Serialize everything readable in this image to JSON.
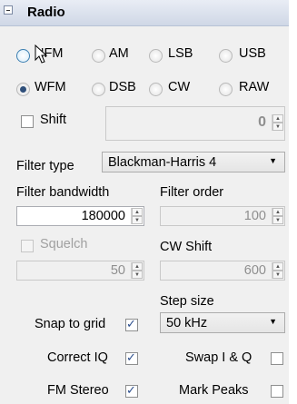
{
  "header": {
    "title": "Radio"
  },
  "modes": {
    "row1": [
      "NFM",
      "AM",
      "LSB",
      "USB"
    ],
    "row2": [
      "WFM",
      "DSB",
      "CW",
      "RAW"
    ],
    "selected": "WFM"
  },
  "shift": {
    "label": "Shift",
    "checked": false,
    "value": "0"
  },
  "filter_type": {
    "label": "Filter type",
    "value": "Blackman-Harris 4"
  },
  "filter_bandwidth": {
    "label": "Filter bandwidth",
    "value": "180000"
  },
  "filter_order": {
    "label": "Filter order",
    "value": "100"
  },
  "squelch": {
    "label": "Squelch",
    "checked": false,
    "value": "50"
  },
  "cw_shift": {
    "label": "CW Shift",
    "value": "600"
  },
  "step_size": {
    "label": "Step size",
    "value": "50 kHz"
  },
  "snap_to_grid": {
    "label": "Snap to grid",
    "checked": true
  },
  "correct_iq": {
    "label": "Correct IQ",
    "checked": true
  },
  "swap_iq": {
    "label": "Swap I & Q",
    "checked": false
  },
  "fm_stereo": {
    "label": "FM Stereo",
    "checked": true
  },
  "mark_peaks": {
    "label": "Mark Peaks",
    "checked": false
  },
  "colors": {
    "header_top": "#e9edf5",
    "header_bottom": "#cfd7e6",
    "panel": "#f0f0f0",
    "accent": "#2b4d8c"
  }
}
